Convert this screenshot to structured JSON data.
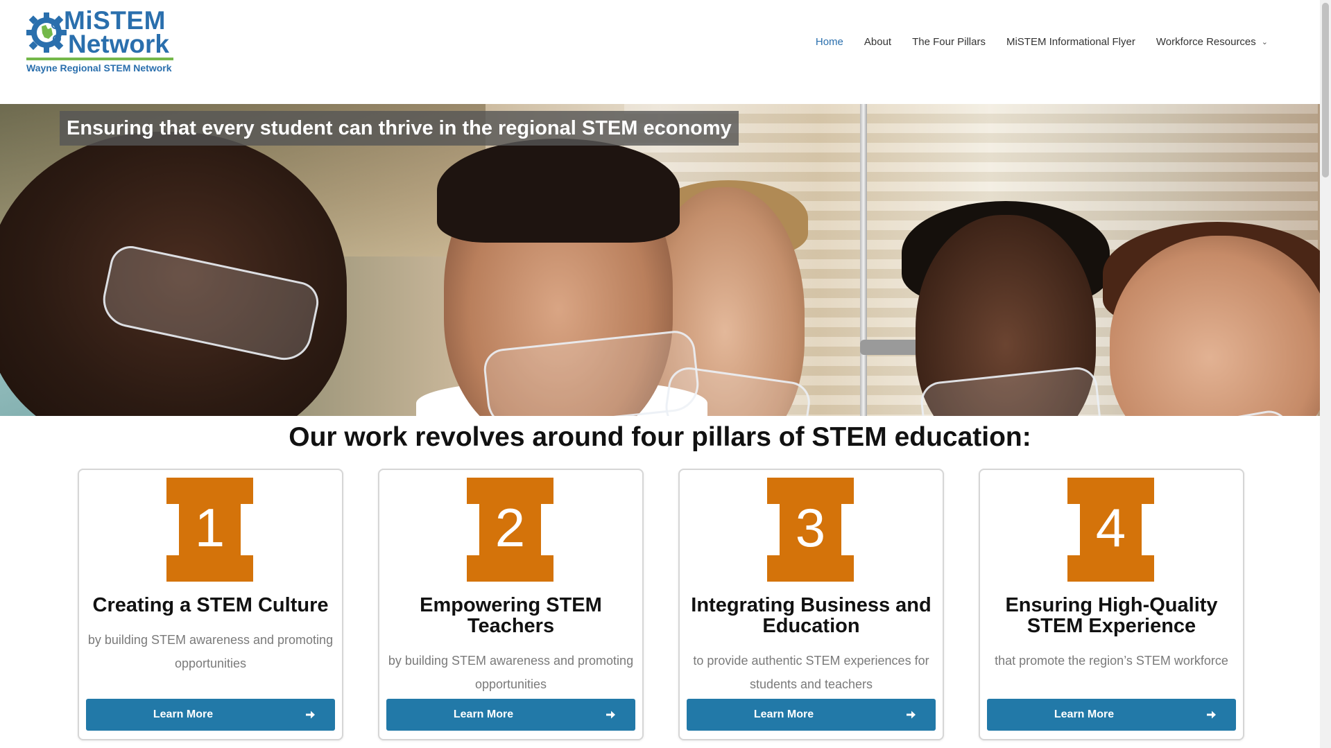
{
  "header": {
    "logo": {
      "mi": "Mi",
      "stem": "STEM",
      "network": "Network",
      "tagline": "Wayne Regional STEM Network",
      "icon": "gear-michigan-icon"
    },
    "nav": [
      {
        "label": "Home",
        "active": true
      },
      {
        "label": "About",
        "active": false
      },
      {
        "label": "The Four Pillars",
        "active": false
      },
      {
        "label": "MiSTEM Informational Flyer",
        "active": false
      },
      {
        "label": "Workforce Resources",
        "active": false,
        "has_dropdown": true
      }
    ]
  },
  "hero": {
    "caption": "Ensuring that every student can thrive in the regional STEM economy",
    "image": "students-wearing-safety-goggles-photo"
  },
  "section": {
    "title": "Our work revolves around four pillars of STEM education:"
  },
  "cards": [
    {
      "number": "1",
      "title_lines": [
        "Creating a STEM Culture"
      ],
      "desc_lines": [
        "by building STEM awareness and promoting",
        "opportunities"
      ],
      "button": "Learn More"
    },
    {
      "number": "2",
      "title_lines": [
        "Empowering STEM",
        "Teachers"
      ],
      "desc_lines": [
        "by building STEM awareness and promoting",
        "opportunities"
      ],
      "button": "Learn More"
    },
    {
      "number": "3",
      "title_lines": [
        "Integrating Business and",
        "Education"
      ],
      "desc_lines": [
        "to provide authentic STEM experiences for",
        "students and teachers"
      ],
      "button": "Learn More"
    },
    {
      "number": "4",
      "title_lines": [
        "Ensuring High-Quality",
        "STEM Experience"
      ],
      "desc_lines": [
        "that promote the region’s STEM workforce"
      ],
      "button": "Learn More"
    }
  ],
  "colors": {
    "brand_blue": "#2a6fad",
    "brand_green": "#74b84a",
    "pillar_orange": "#d4730a",
    "button_blue": "#2279a8"
  }
}
